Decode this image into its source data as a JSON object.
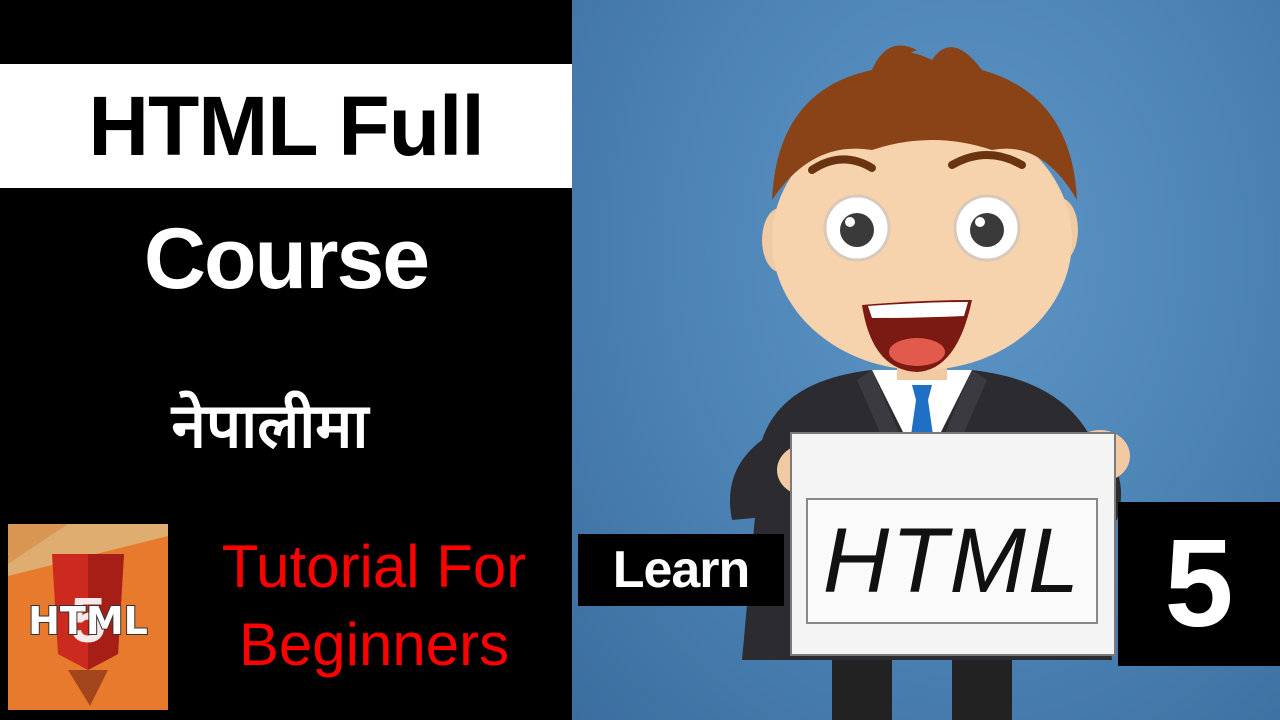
{
  "title": {
    "line1": "HTML Full",
    "line2": "Course",
    "nepali": "नेपालीमा"
  },
  "logo": {
    "text": "HTML",
    "number": "5",
    "icon": "html5-logo-icon"
  },
  "tagline": {
    "line1": "Tutorial For",
    "line2": "Beginners"
  },
  "badges": {
    "learn": "Learn",
    "sign": "HTML",
    "five": "5"
  },
  "colors": {
    "accent_red": "#ff0000",
    "background_blue": "#4f86b8",
    "logo_orange": "#e77a2c",
    "panel_black": "#000000"
  }
}
